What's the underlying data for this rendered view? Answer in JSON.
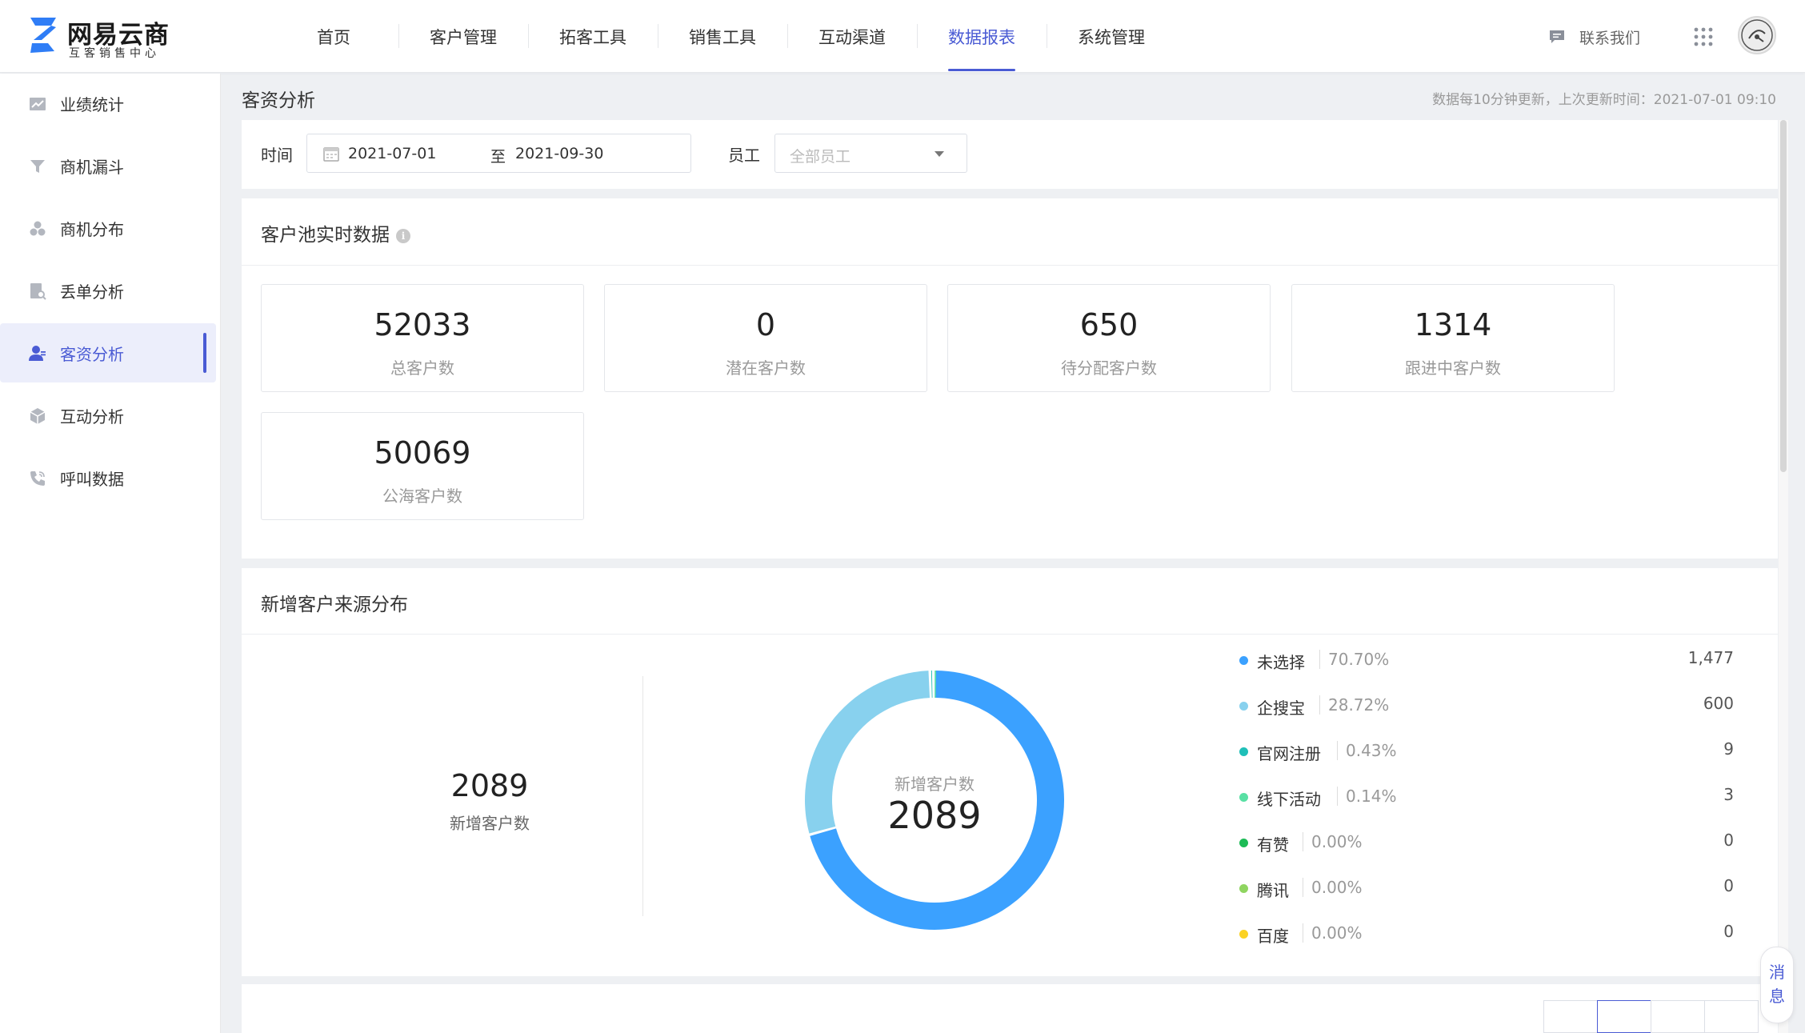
{
  "app": {
    "logo_title": "网易云商",
    "logo_subtitle": "互客销售中心",
    "brand_color": "#4a5bd4"
  },
  "nav": {
    "items": [
      {
        "label": "首页"
      },
      {
        "label": "客户管理"
      },
      {
        "label": "拓客工具"
      },
      {
        "label": "销售工具"
      },
      {
        "label": "互动渠道"
      },
      {
        "label": "数据报表",
        "active": true
      },
      {
        "label": "系统管理"
      }
    ],
    "contact_label": "联系我们",
    "contact_icon": "chat-icon",
    "apps_icon": "grid-icon"
  },
  "sidebar": {
    "items": [
      {
        "label": "业绩统计",
        "icon": "trend-chart-icon"
      },
      {
        "label": "商机漏斗",
        "icon": "funnel-icon"
      },
      {
        "label": "商机分布",
        "icon": "cluster-icon"
      },
      {
        "label": "丢单分析",
        "icon": "document-search-icon"
      },
      {
        "label": "客资分析",
        "icon": "user-icon",
        "active": true
      },
      {
        "label": "互动分析",
        "icon": "cube-icon"
      },
      {
        "label": "呼叫数据",
        "icon": "phone-icon"
      }
    ]
  },
  "page": {
    "title": "客资分析",
    "update_note": "数据每10分钟更新，上次更新时间：2021-07-01 09:10"
  },
  "filters": {
    "time_label": "时间",
    "start_date": "2021-07-01",
    "range_separator": "至",
    "end_date": "2021-09-30",
    "staff_label": "员工",
    "staff_placeholder": "全部员工"
  },
  "pool": {
    "title": "客户池实时数据",
    "info_icon": "i",
    "stats": [
      {
        "value": "52033",
        "label": "总客户数"
      },
      {
        "value": "0",
        "label": "潜在客户数"
      },
      {
        "value": "650",
        "label": "待分配客户数"
      },
      {
        "value": "1314",
        "label": "跟进中客户数"
      },
      {
        "value": "50069",
        "label": "公海客户数"
      }
    ]
  },
  "sources": {
    "title": "新增客户来源分布",
    "total_value": "2089",
    "total_label": "新增客户数",
    "donut_label": "新增客户数",
    "donut_value": "2089"
  },
  "chart_data": {
    "type": "pie",
    "donut": true,
    "total": 2089,
    "series": [
      {
        "name": "未选择",
        "percent": "70.70%",
        "value": 1477,
        "value_label": "1,477",
        "color": "#3ba1ff"
      },
      {
        "name": "企搜宝",
        "percent": "28.72%",
        "value": 600,
        "value_label": "600",
        "color": "#88d1ee"
      },
      {
        "name": "官网注册",
        "percent": "0.43%",
        "value": 9,
        "value_label": "9",
        "color": "#1fbfb8"
      },
      {
        "name": "线下活动",
        "percent": "0.14%",
        "value": 3,
        "value_label": "3",
        "color": "#59e0a4"
      },
      {
        "name": "有赞",
        "percent": "0.00%",
        "value": 0,
        "value_label": "0",
        "color": "#1dbb56"
      },
      {
        "name": "腾讯",
        "percent": "0.00%",
        "value": 0,
        "value_label": "0",
        "color": "#8fd560"
      },
      {
        "name": "百度",
        "percent": "0.00%",
        "value": 0,
        "value_label": "0",
        "color": "#fbd223"
      }
    ]
  },
  "message_tab": {
    "label_line1": "消",
    "label_line2": "息"
  }
}
